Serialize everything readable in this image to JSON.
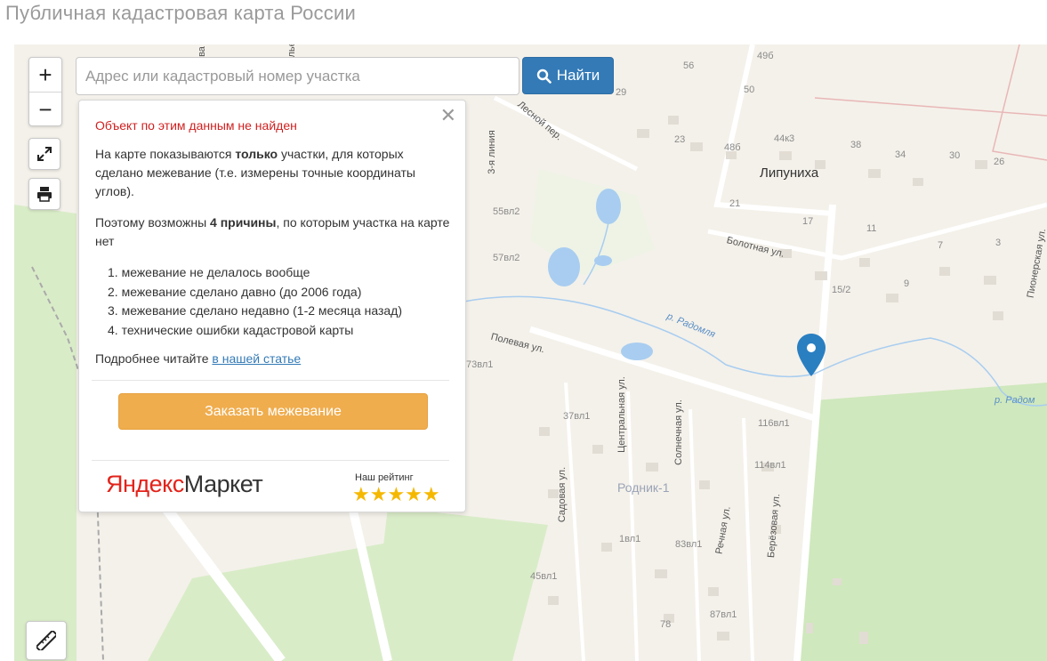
{
  "page": {
    "title": "Публичная кадастровая карта России"
  },
  "search": {
    "placeholder": "Адрес или кадастровый номер участка",
    "button_label": "Найти"
  },
  "controls": {
    "zoom_in": "+",
    "zoom_out": "−"
  },
  "popup": {
    "error": "Объект по этим данным не найден",
    "p1_before": "На карте показываются ",
    "p1_bold": "только",
    "p1_after": " участки, для которых сделано межевание (т.е. измерены точные координаты углов).",
    "p2_before": "Поэтому возможны ",
    "p2_bold": "4 причины",
    "p2_after": ", по которым участка на карте нет",
    "reasons": [
      "1. межевание не делалось вообще",
      "2. межевание сделано давно (до 2006 года)",
      "3. межевание сделано недавно (1-2 месяца назад)",
      "4. технические ошибки кадастровой карты"
    ],
    "more_text": "Подробнее читайте ",
    "more_link": "в нашей статье",
    "order_button": "Заказать межевание",
    "market_brand_ya": "Яндекс",
    "market_brand_rest": "Маркет",
    "rating_label": "Наш рейтинг",
    "stars": "★★★★★",
    "rating_value": 5
  },
  "map": {
    "town": "Липуниха",
    "district": "Родник-1",
    "rivers": [
      "р. Радомля",
      "р. Радом"
    ],
    "streets": [
      "Лесной пер.",
      "3-я линия",
      "Болотная ул.",
      "Полевая ул.",
      "Центральная ул.",
      "Солнечная ул.",
      "Садовая ул.",
      "Речная ул.",
      "Берёзовая ул.",
      "Пионерская ул."
    ],
    "numbers": [
      "56",
      "50",
      "49б",
      "29",
      "23",
      "48б",
      "44к3",
      "38",
      "34",
      "30",
      "26",
      "21",
      "17",
      "11",
      "7",
      "3",
      "15/2",
      "9",
      "55вл2",
      "57вл2",
      "73вл1",
      "37вл1",
      "116вл1",
      "114вл1",
      "1вл1",
      "83вл1",
      "45вл1",
      "87вл1",
      "78"
    ],
    "partial": [
      "ва",
      "улье",
      "ев"
    ]
  }
}
